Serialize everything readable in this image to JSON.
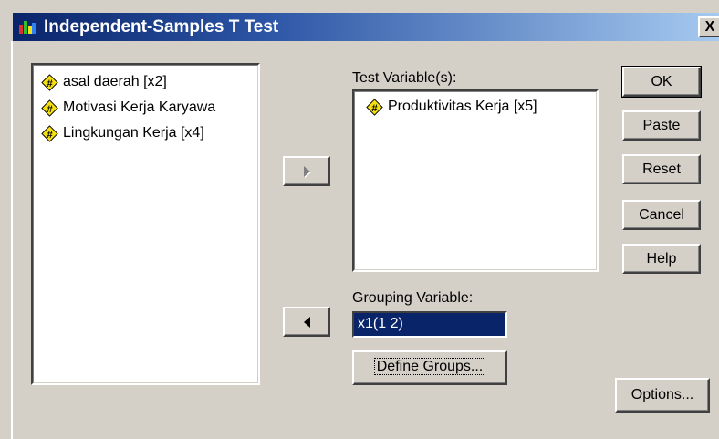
{
  "window": {
    "title": "Independent-Samples T Test",
    "close_label": "X"
  },
  "source_list": {
    "items": [
      {
        "label": "asal daerah [x2]",
        "icon": "scale-variable-icon"
      },
      {
        "label": "Motivasi Kerja Karyawa",
        "icon": "scale-variable-icon"
      },
      {
        "label": "Lingkungan Kerja [x4]",
        "icon": "scale-variable-icon"
      }
    ]
  },
  "test_variables": {
    "label": "Test Variable(s):",
    "items": [
      {
        "label": "Produktivitas Kerja [x5]",
        "icon": "scale-variable-icon"
      }
    ]
  },
  "grouping": {
    "label": "Grouping Variable:",
    "value": "x1(1 2)",
    "define_label": "Define Groups..."
  },
  "buttons": {
    "ok": "OK",
    "paste": "Paste",
    "reset": "Reset",
    "cancel": "Cancel",
    "help": "Help",
    "options": "Options..."
  },
  "colors": {
    "dialog_bg": "#d4d0c8",
    "title_start": "#0a246a",
    "title_end": "#a6caf0",
    "icon_yellow": "#f5e010",
    "selection": "#0a246a"
  }
}
